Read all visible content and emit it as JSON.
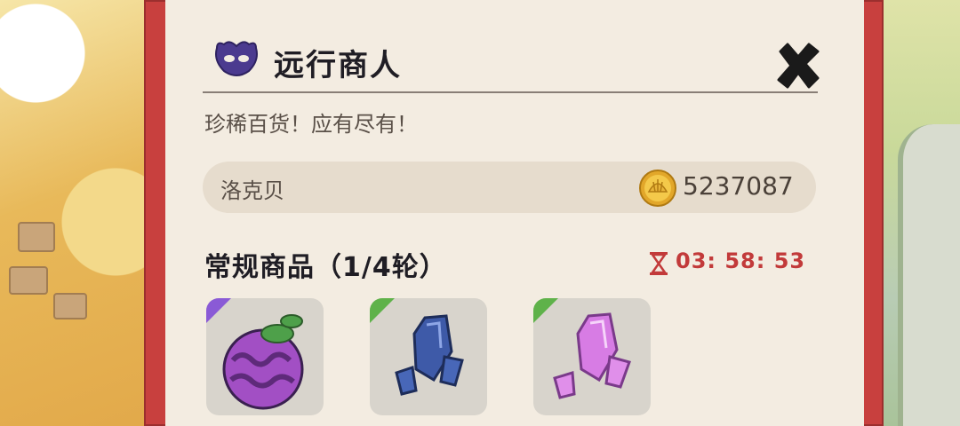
{
  "header": {
    "title": "远行商人",
    "icon": "merchant-mask-icon",
    "close_icon": "close-icon"
  },
  "subtitle": "珍稀百货！应有尽有！",
  "currency": {
    "name": "洛克贝",
    "amount": "5237087",
    "icon": "gold-shell-coin-icon"
  },
  "section": {
    "title": "常规商品（1/4轮）",
    "timer": "03: 58: 53",
    "timer_icon": "hourglass-icon"
  },
  "items": [
    {
      "name": "purple-swirl-fruit",
      "rarity_color": "#8a5ad6"
    },
    {
      "name": "blue-crystal",
      "rarity_color": "#5fb24a"
    },
    {
      "name": "pink-crystal",
      "rarity_color": "#5fb24a"
    }
  ],
  "colors": {
    "frame": "#c8403e",
    "panel": "#f3ece1",
    "timer": "#c23a3a"
  }
}
